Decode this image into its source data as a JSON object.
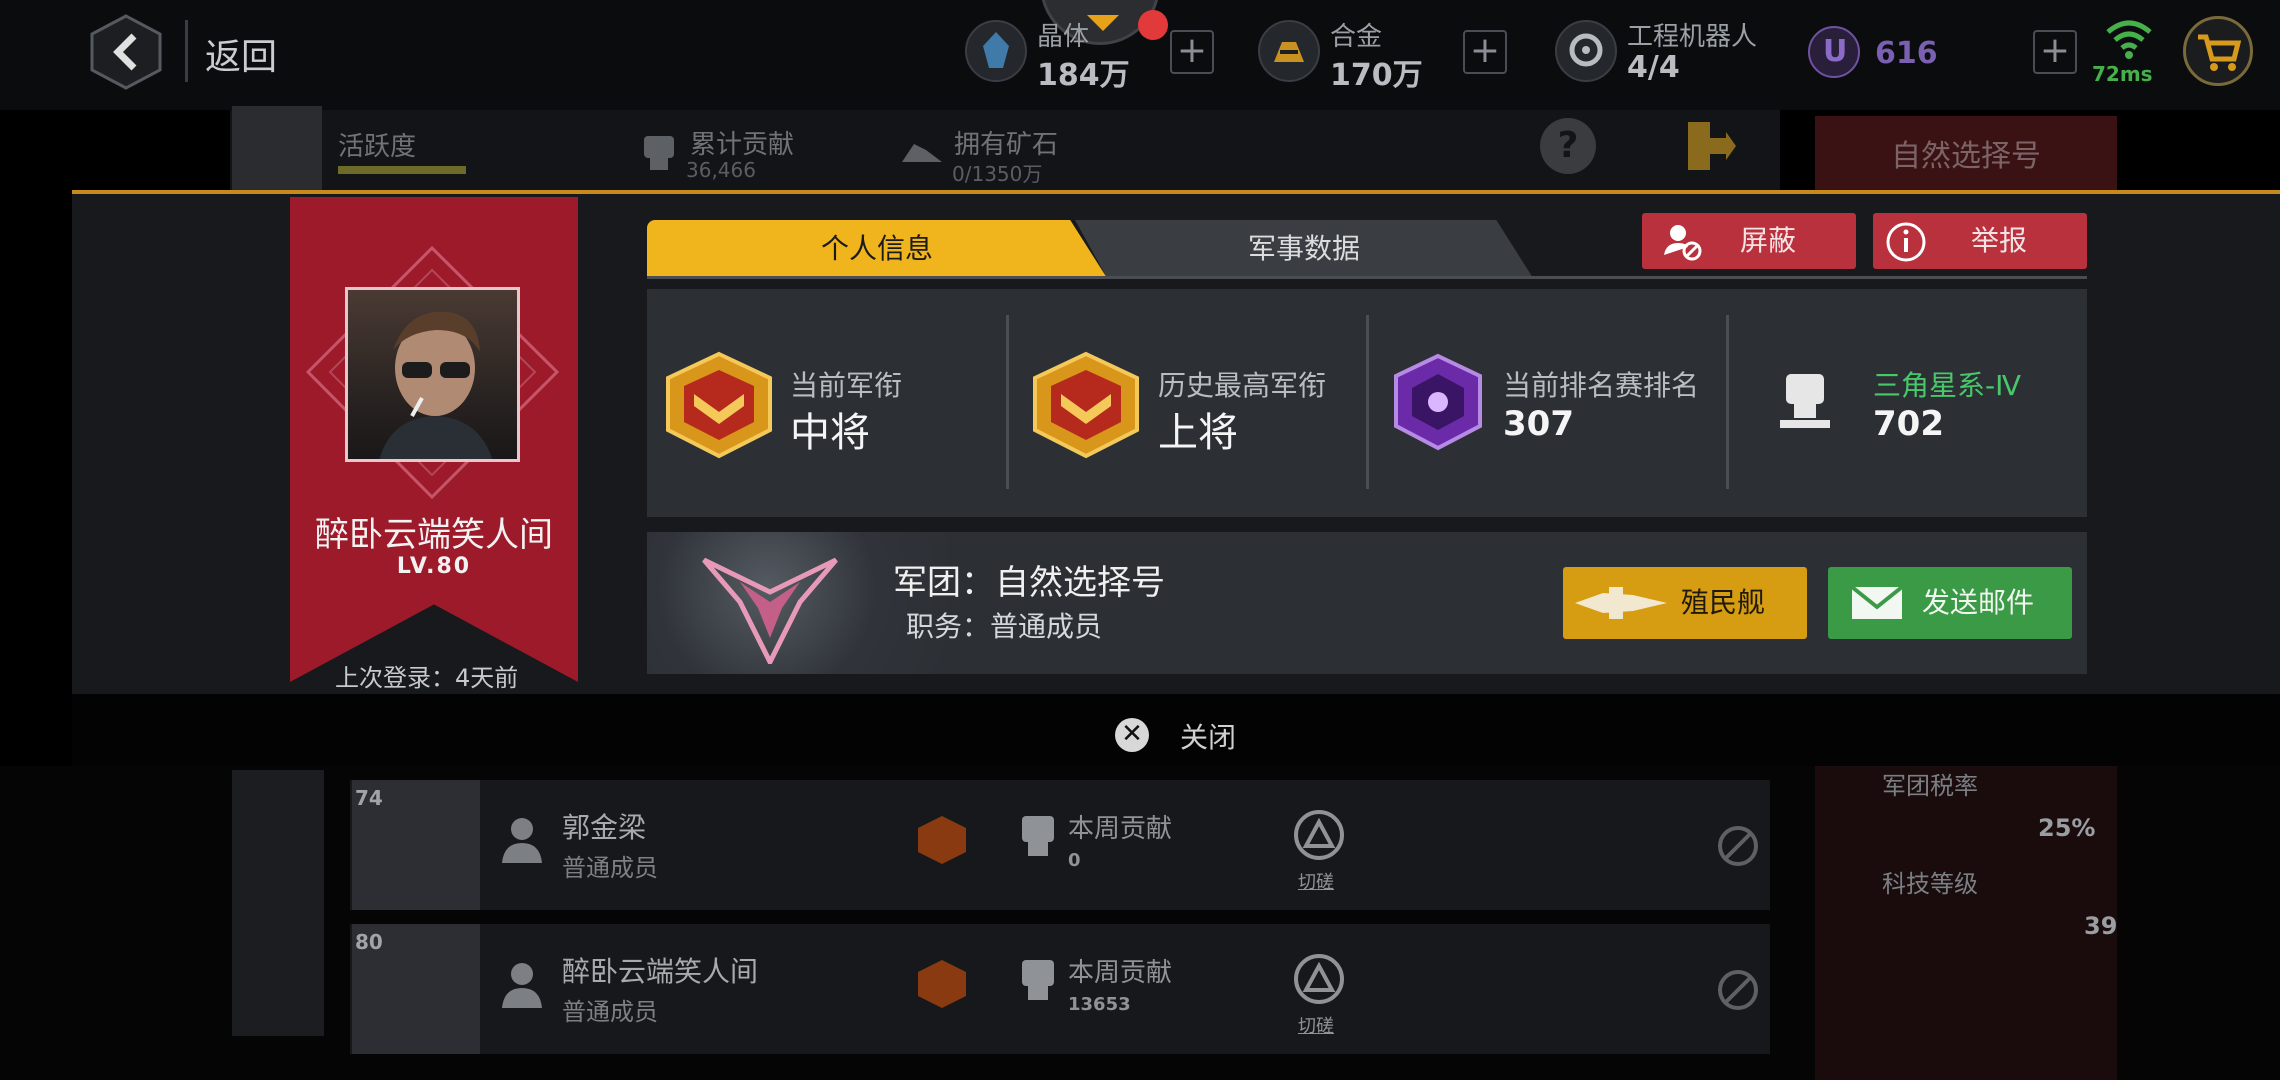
{
  "topbar": {
    "back_label": "返回",
    "crystal": {
      "name": "晶体",
      "value": "184万"
    },
    "alloy": {
      "name": "合金",
      "value": "170万"
    },
    "robot": {
      "name": "工程机器人",
      "value": "4/4"
    },
    "u_currency": {
      "symbol": "U",
      "value": "616"
    },
    "ping": "72ms"
  },
  "background": {
    "activity_label": "活跃度",
    "contribution_label": "累计贡献",
    "contribution_value": "36,466",
    "ore_label": "拥有矿石",
    "ore_value": "0/1350万",
    "help_symbol": "?",
    "legion_button": "自然选择号"
  },
  "profile": {
    "name": "醉卧云端笑人间",
    "level": "LV.80",
    "last_login": "上次登录：4天前",
    "tabs": [
      {
        "label": "个人信息"
      },
      {
        "label": "军事数据"
      }
    ],
    "block_label": "屏蔽",
    "report_label": "举报",
    "stats": {
      "current_rank_label": "当前军衔",
      "current_rank": "中将",
      "highest_rank_label": "历史最高军衔",
      "highest_rank": "上将",
      "ladder_rank_label": "当前排名赛排名",
      "ladder_rank": "307",
      "galaxy_label": "三角星系-Ⅳ",
      "galaxy_value": "702"
    },
    "legion": {
      "name": "军团：自然选择号",
      "role": "职务：普通成员",
      "colony_label": "殖民舰",
      "mail_label": "发送邮件"
    },
    "close_label": "关闭",
    "close_symbol": "✕"
  },
  "members": [
    {
      "level": "74",
      "name": "郭金梁",
      "role": "普通成员",
      "contrib_label": "本周贡献",
      "contrib_value": "0",
      "switch": "切磋"
    },
    {
      "level": "80",
      "name": "醉卧云端笑人间",
      "role": "普通成员",
      "contrib_label": "本周贡献",
      "contrib_value": "13653",
      "switch": "切磋"
    }
  ],
  "right_panel": {
    "tax_label": "军团税率",
    "tax_value": "25%",
    "tech_label": "科技等级",
    "tech_value": "39"
  },
  "colors": {
    "gold": "#f0b41d",
    "red": "#b9313d",
    "green": "#3b9a46",
    "banner": "#9d1a2a"
  }
}
